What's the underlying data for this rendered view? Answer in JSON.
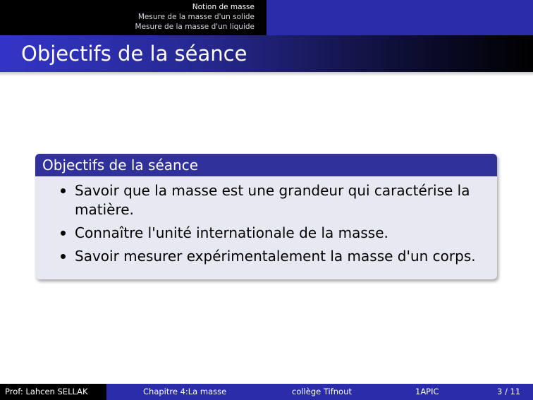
{
  "navigation": {
    "sections": [
      "Notion de masse",
      "Mesure de la masse d'un solide",
      "Mesure de la masse d'un liquide"
    ]
  },
  "frame": {
    "title": "Objectifs de la séance"
  },
  "block": {
    "title": "Objectifs de la séance",
    "items": [
      "Savoir que la masse est une grandeur qui caractérise la matière.",
      "Connaître l'unité internationale de la masse.",
      "Savoir mesurer expérimentalement la masse d'un corps."
    ]
  },
  "footer": {
    "author": "Prof: Lahcen SELLAK",
    "chapter": "Chapitre 4:La masse",
    "school": "collège Tifnout",
    "class": "1APIC",
    "page": "3 / 11"
  },
  "colors": {
    "theme_blue": "#2a2ca9",
    "block_header": "#30319b",
    "block_body": "#e8e8f3"
  }
}
